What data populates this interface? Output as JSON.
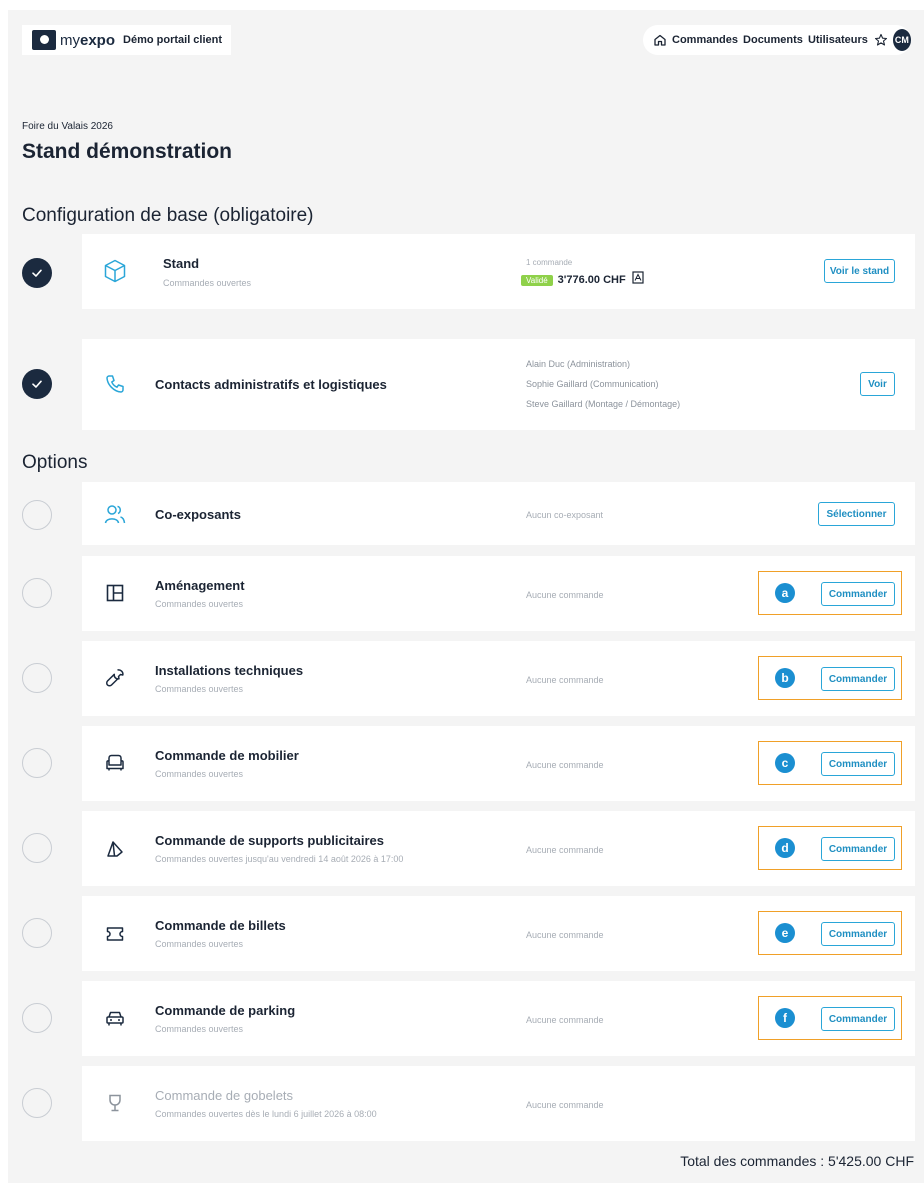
{
  "header": {
    "logo_my": "my",
    "logo_expo": "expo",
    "portal_label": "Démo portail client",
    "nav": [
      "Commandes",
      "Documents",
      "Utilisateurs"
    ],
    "avatar_initials": "CM"
  },
  "event_name": "Foire du Valais 2026",
  "page_title": "Stand démonstration",
  "base_section": {
    "title": "Configuration de base (obligatoire)",
    "stand": {
      "title": "Stand",
      "subtitle": "Commandes ouvertes",
      "orders_count": "1 commande",
      "status_badge": "Validé",
      "amount": "3'776.00 CHF",
      "button": "Voir le stand"
    },
    "contacts": {
      "title": "Contacts administratifs et logistiques",
      "people": [
        "Alain Duc (Administration)",
        "Sophie Gaillard (Communication)",
        "Steve Gaillard (Montage / Démontage)"
      ],
      "button": "Voir"
    }
  },
  "options_section": {
    "title": "Options",
    "coexposants": {
      "title": "Co-exposants",
      "status": "Aucun co-exposant",
      "button": "Sélectionner"
    },
    "items": [
      {
        "letter": "a",
        "title": "Aménagement",
        "subtitle": "Commandes ouvertes",
        "status": "Aucune commande",
        "button": "Commander",
        "icon": "layout-icon"
      },
      {
        "letter": "b",
        "title": "Installations techniques",
        "subtitle": "Commandes ouvertes",
        "status": "Aucune commande",
        "button": "Commander",
        "icon": "wrench-icon"
      },
      {
        "letter": "c",
        "title": "Commande de mobilier",
        "subtitle": "Commandes ouvertes",
        "status": "Aucune commande",
        "button": "Commander",
        "icon": "armchair-icon"
      },
      {
        "letter": "d",
        "title": "Commande de supports publicitaires",
        "subtitle": "Commandes ouvertes jusqu'au vendredi 14 août 2026 à 17:00",
        "status": "Aucune commande",
        "button": "Commander",
        "icon": "flag-icon"
      },
      {
        "letter": "e",
        "title": "Commande de billets",
        "subtitle": "Commandes ouvertes",
        "status": "Aucune commande",
        "button": "Commander",
        "icon": "ticket-icon"
      },
      {
        "letter": "f",
        "title": "Commande de parking",
        "subtitle": "Commandes ouvertes",
        "status": "Aucune commande",
        "button": "Commander",
        "icon": "car-icon"
      }
    ],
    "gobelets": {
      "title": "Commande de gobelets",
      "subtitle": "Commandes ouvertes dès le lundi 6 juillet 2026 à 08:00",
      "status": "Aucune commande"
    }
  },
  "total": "Total des commandes : 5'425.00 CHF",
  "colors": {
    "navy": "#1b2a3f",
    "accent": "#2aa6d8",
    "highlight": "#f0a028",
    "badge_green": "#8fd14a"
  }
}
